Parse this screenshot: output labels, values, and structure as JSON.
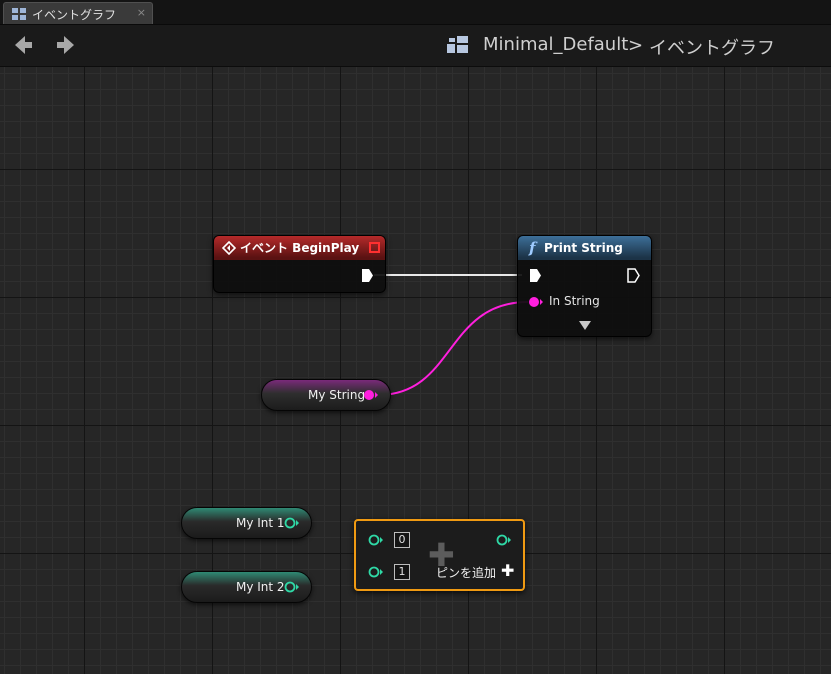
{
  "tab": {
    "label": "イベントグラフ",
    "close_glyph": "×"
  },
  "breadcrumb": {
    "root": "Minimal_Default",
    "separator": ">",
    "current": "イベントグラフ"
  },
  "nodes": {
    "begin_play": {
      "title": "イベント BeginPlay",
      "header_color": "#b52a2a"
    },
    "print_string": {
      "title": "Print String",
      "icon_glyph": "f",
      "in_string_label": "In String",
      "header_color": "#3d6f99"
    },
    "my_string": {
      "label": "My String",
      "pin_color": "#ff1fde"
    },
    "my_int_1": {
      "label": "My Int 1",
      "pin_color": "#2fd9a6"
    },
    "my_int_2": {
      "label": "My Int 2",
      "pin_color": "#2fd9a6"
    },
    "add_node": {
      "index_0": "0",
      "index_1": "1",
      "add_pin_label": "ピンを追加",
      "add_pin_glyph": "✚",
      "center_glyph": "✚",
      "border_color": "#f09a12"
    }
  },
  "colors": {
    "exec_wire": "#e8e8e8",
    "string_wire": "#ff1fde",
    "int_pin": "#2fd9a6"
  }
}
